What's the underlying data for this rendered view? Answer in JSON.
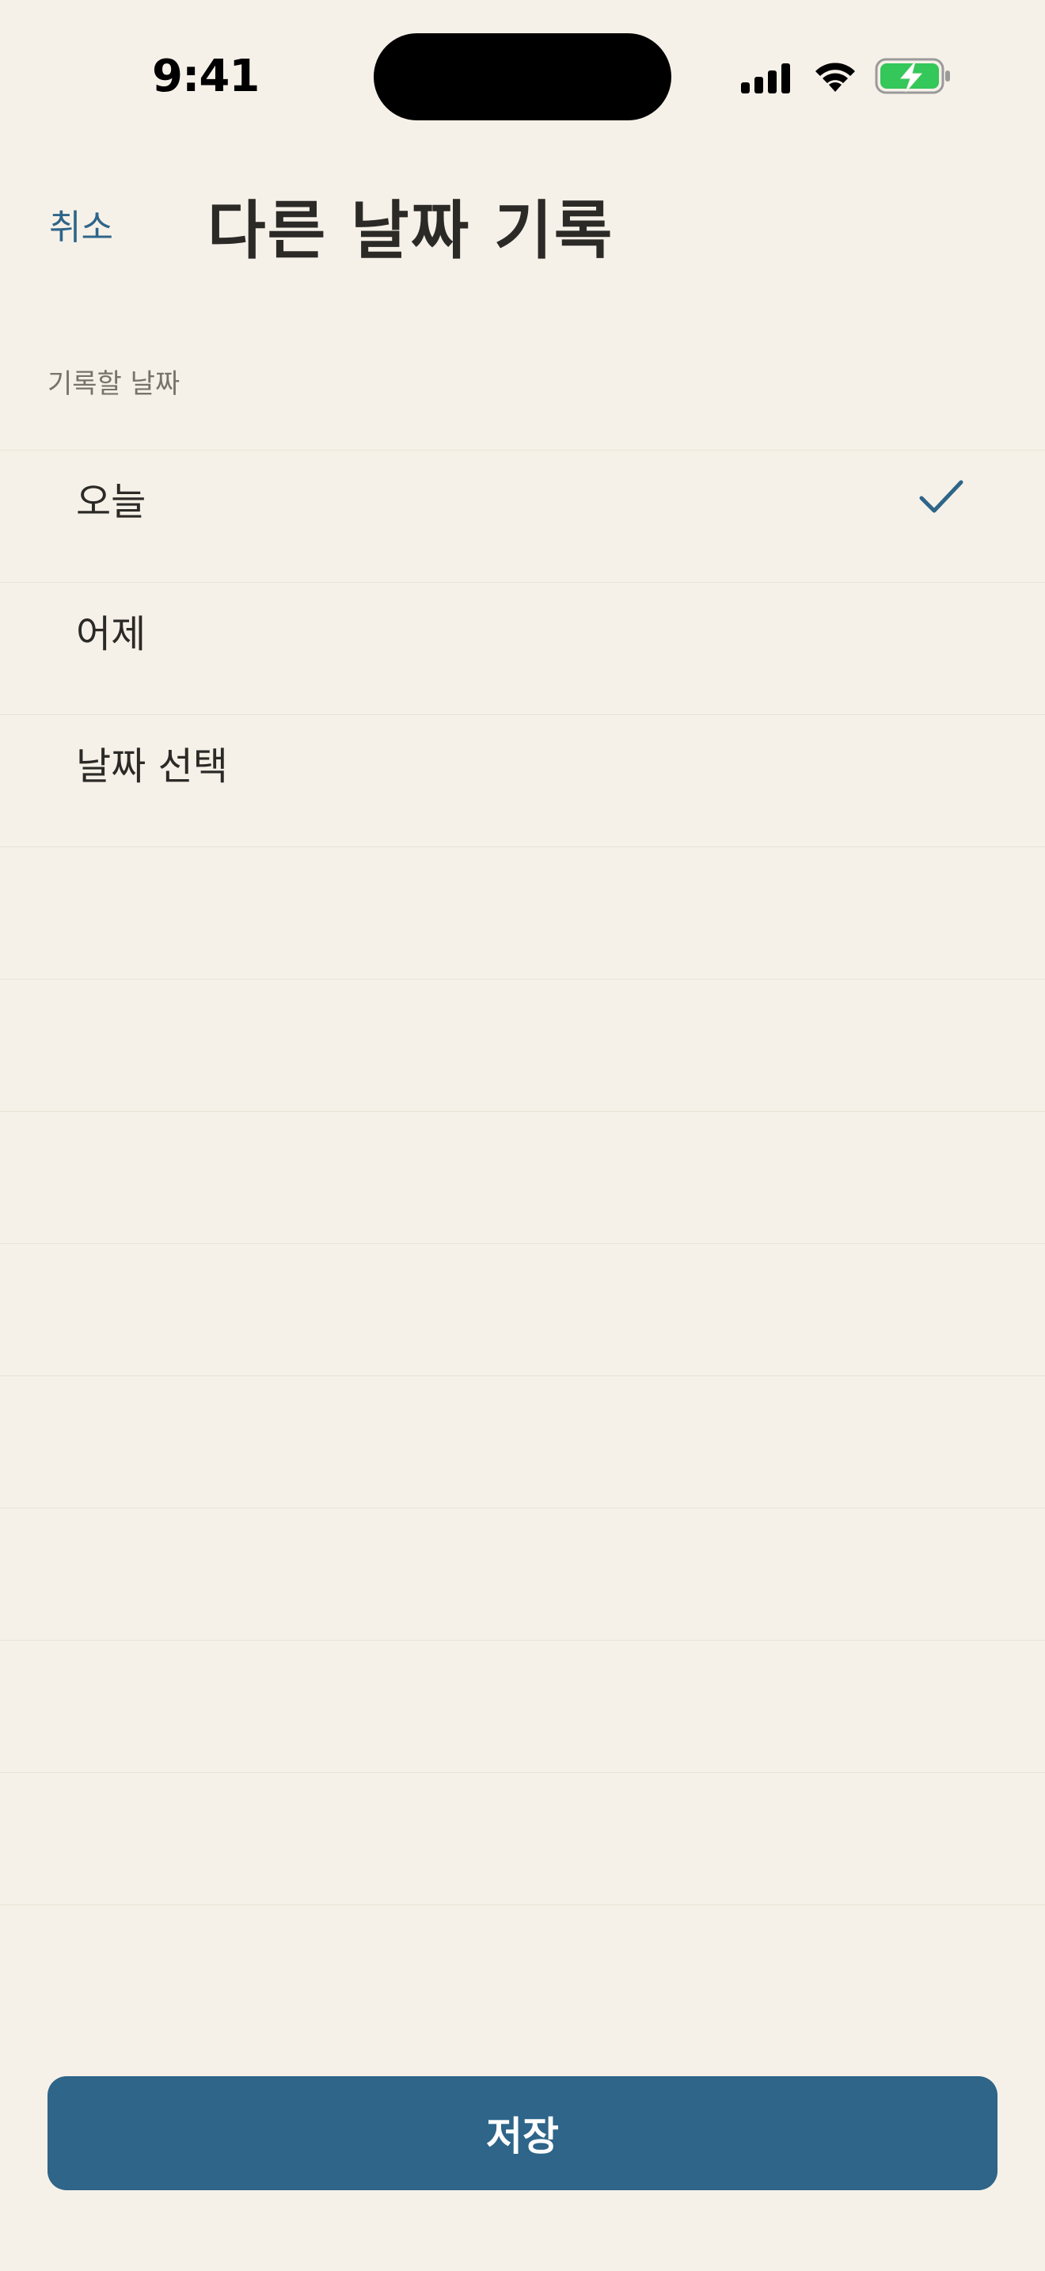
{
  "status_bar": {
    "time": "9:41",
    "icons": [
      "cellular-signal-icon",
      "wifi-icon",
      "battery-charging-icon"
    ]
  },
  "header": {
    "cancel_label": "취소",
    "title": "다른 날짜 기록"
  },
  "section": {
    "label": "기록할 날짜"
  },
  "options": [
    {
      "label": "오늘",
      "selected": true
    },
    {
      "label": "어제",
      "selected": false
    },
    {
      "label": "날짜 선택",
      "selected": false
    }
  ],
  "footer": {
    "save_label": "저장"
  },
  "colors": {
    "background": "#f6f1e8",
    "accent": "#2e6589",
    "text": "#2b2a27",
    "secondary_text": "#77736b",
    "battery_green": "#34c759"
  }
}
